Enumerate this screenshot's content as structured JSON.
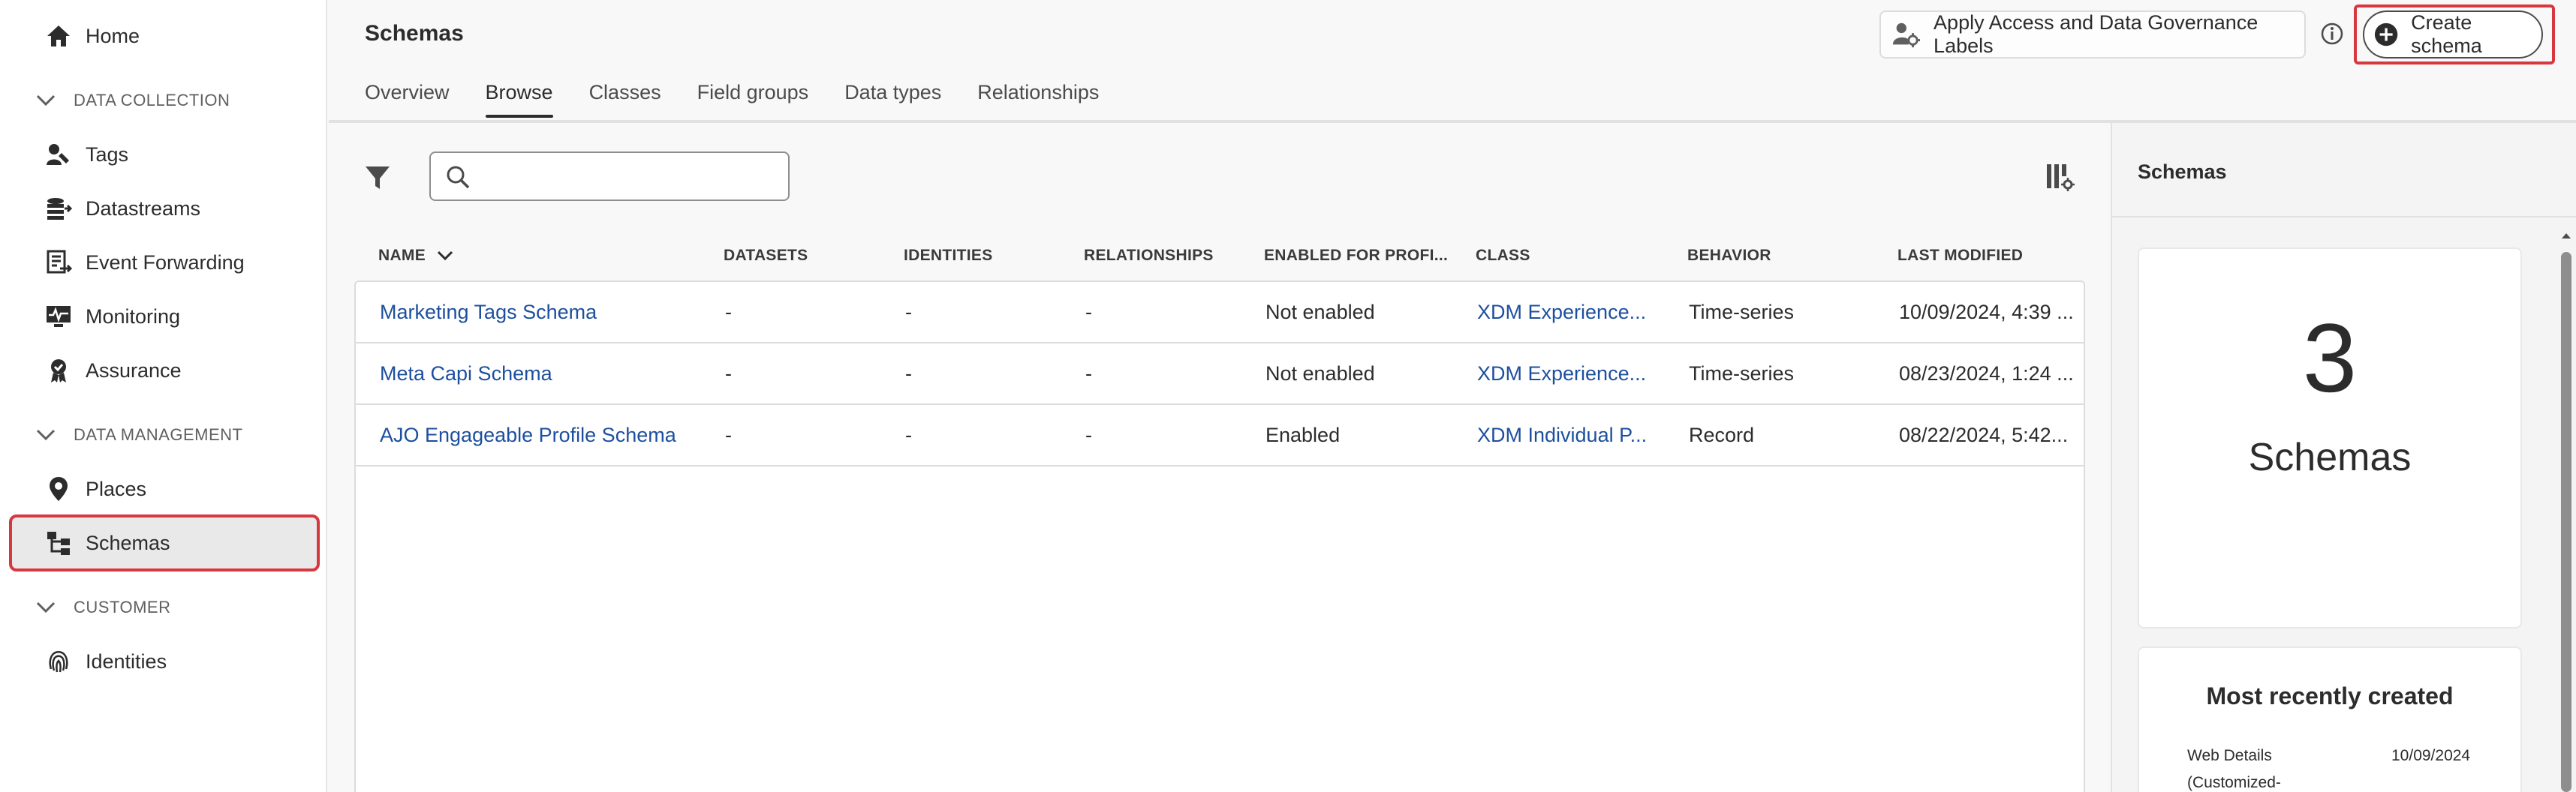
{
  "sidebar": {
    "home": "Home",
    "sections": [
      {
        "label": "DATA COLLECTION"
      },
      {
        "label": "DATA MANAGEMENT"
      },
      {
        "label": "CUSTOMER"
      }
    ],
    "items": [
      {
        "label": "Tags",
        "icon": "tags-icon"
      },
      {
        "label": "Datastreams",
        "icon": "datastreams-icon"
      },
      {
        "label": "Event Forwarding",
        "icon": "event-forwarding-icon"
      },
      {
        "label": "Monitoring",
        "icon": "monitoring-icon"
      },
      {
        "label": "Assurance",
        "icon": "assurance-icon"
      },
      {
        "label": "Places",
        "icon": "places-icon"
      },
      {
        "label": "Schemas",
        "icon": "schemas-icon",
        "selected": true
      },
      {
        "label": "Identities",
        "icon": "identities-icon"
      }
    ]
  },
  "header": {
    "title": "Schemas",
    "tabs": [
      "Overview",
      "Browse",
      "Classes",
      "Field groups",
      "Data types",
      "Relationships"
    ],
    "active_tab": "Browse",
    "governance_button": "Apply Access and Data Governance Labels",
    "create_button": "Create schema"
  },
  "search": {
    "placeholder": "",
    "value": ""
  },
  "table": {
    "columns": [
      "NAME",
      "DATASETS",
      "IDENTITIES",
      "RELATIONSHIPS",
      "ENABLED FOR PROFI...",
      "CLASS",
      "BEHAVIOR",
      "LAST MODIFIED"
    ],
    "rows": [
      [
        "Marketing Tags Schema",
        "-",
        "-",
        "-",
        "Not enabled",
        "XDM Experience...",
        "Time-series",
        "10/09/2024, 4:39 ..."
      ],
      [
        "Meta Capi Schema",
        "-",
        "-",
        "-",
        "Not enabled",
        "XDM Experience...",
        "Time-series",
        "08/23/2024, 1:24 ..."
      ],
      [
        "AJO Engageable Profile Schema",
        "-",
        "-",
        "-",
        "Enabled",
        "XDM Individual P...",
        "Record",
        "08/22/2024, 5:42..."
      ]
    ]
  },
  "right_panel": {
    "title": "Schemas",
    "count": "3",
    "count_label": "Schemas",
    "recent_title": "Most recently created",
    "recent_name": "Web Details (Customized-",
    "recent_date": "10/09/2024"
  },
  "colors": {
    "accent_red": "#d7373f",
    "link": "#1d4f9e",
    "text": "#2c2c2c"
  }
}
